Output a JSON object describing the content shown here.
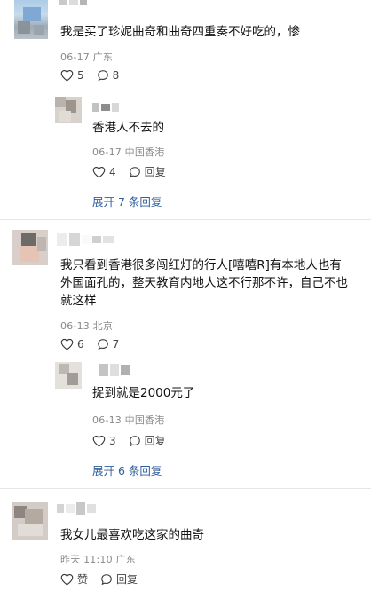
{
  "comments": [
    {
      "text": "我是买了珍妮曲奇和曲奇四重奏不好吃的，惨",
      "date": "06-17",
      "location": "广东",
      "likes": "5",
      "replies_count": "8",
      "reply": {
        "text": "香港人不去的",
        "date": "06-17",
        "location": "中国香港",
        "likes": "4",
        "reply_label": "回复"
      },
      "expand_label": "展开 7 条回复"
    },
    {
      "text_line1": "我只看到香港很多闯红灯的行人[嘻嘻R]有本地人也有",
      "text_line2": "外国面孔的，整天教育内地人这不行那不许，自己不也",
      "text_line3": "就这样",
      "date": "06-13",
      "location": "北京",
      "likes": "6",
      "replies_count": "7",
      "reply": {
        "text": "捉到就是2000元了",
        "date": "06-13",
        "location": "中国香港",
        "likes": "3",
        "reply_label": "回复"
      },
      "expand_label": "展开 6 条回复"
    },
    {
      "text": "我女儿最喜欢吃这家的曲奇",
      "date": "昨天 11:10",
      "location": "广东",
      "likes": "赞",
      "reply_label": "回复"
    }
  ],
  "icons": {
    "like": "heart-icon",
    "comment": "comment-bubble-icon"
  },
  "colors": {
    "link": "#2f5e9a",
    "meta": "#8a8a8a"
  }
}
